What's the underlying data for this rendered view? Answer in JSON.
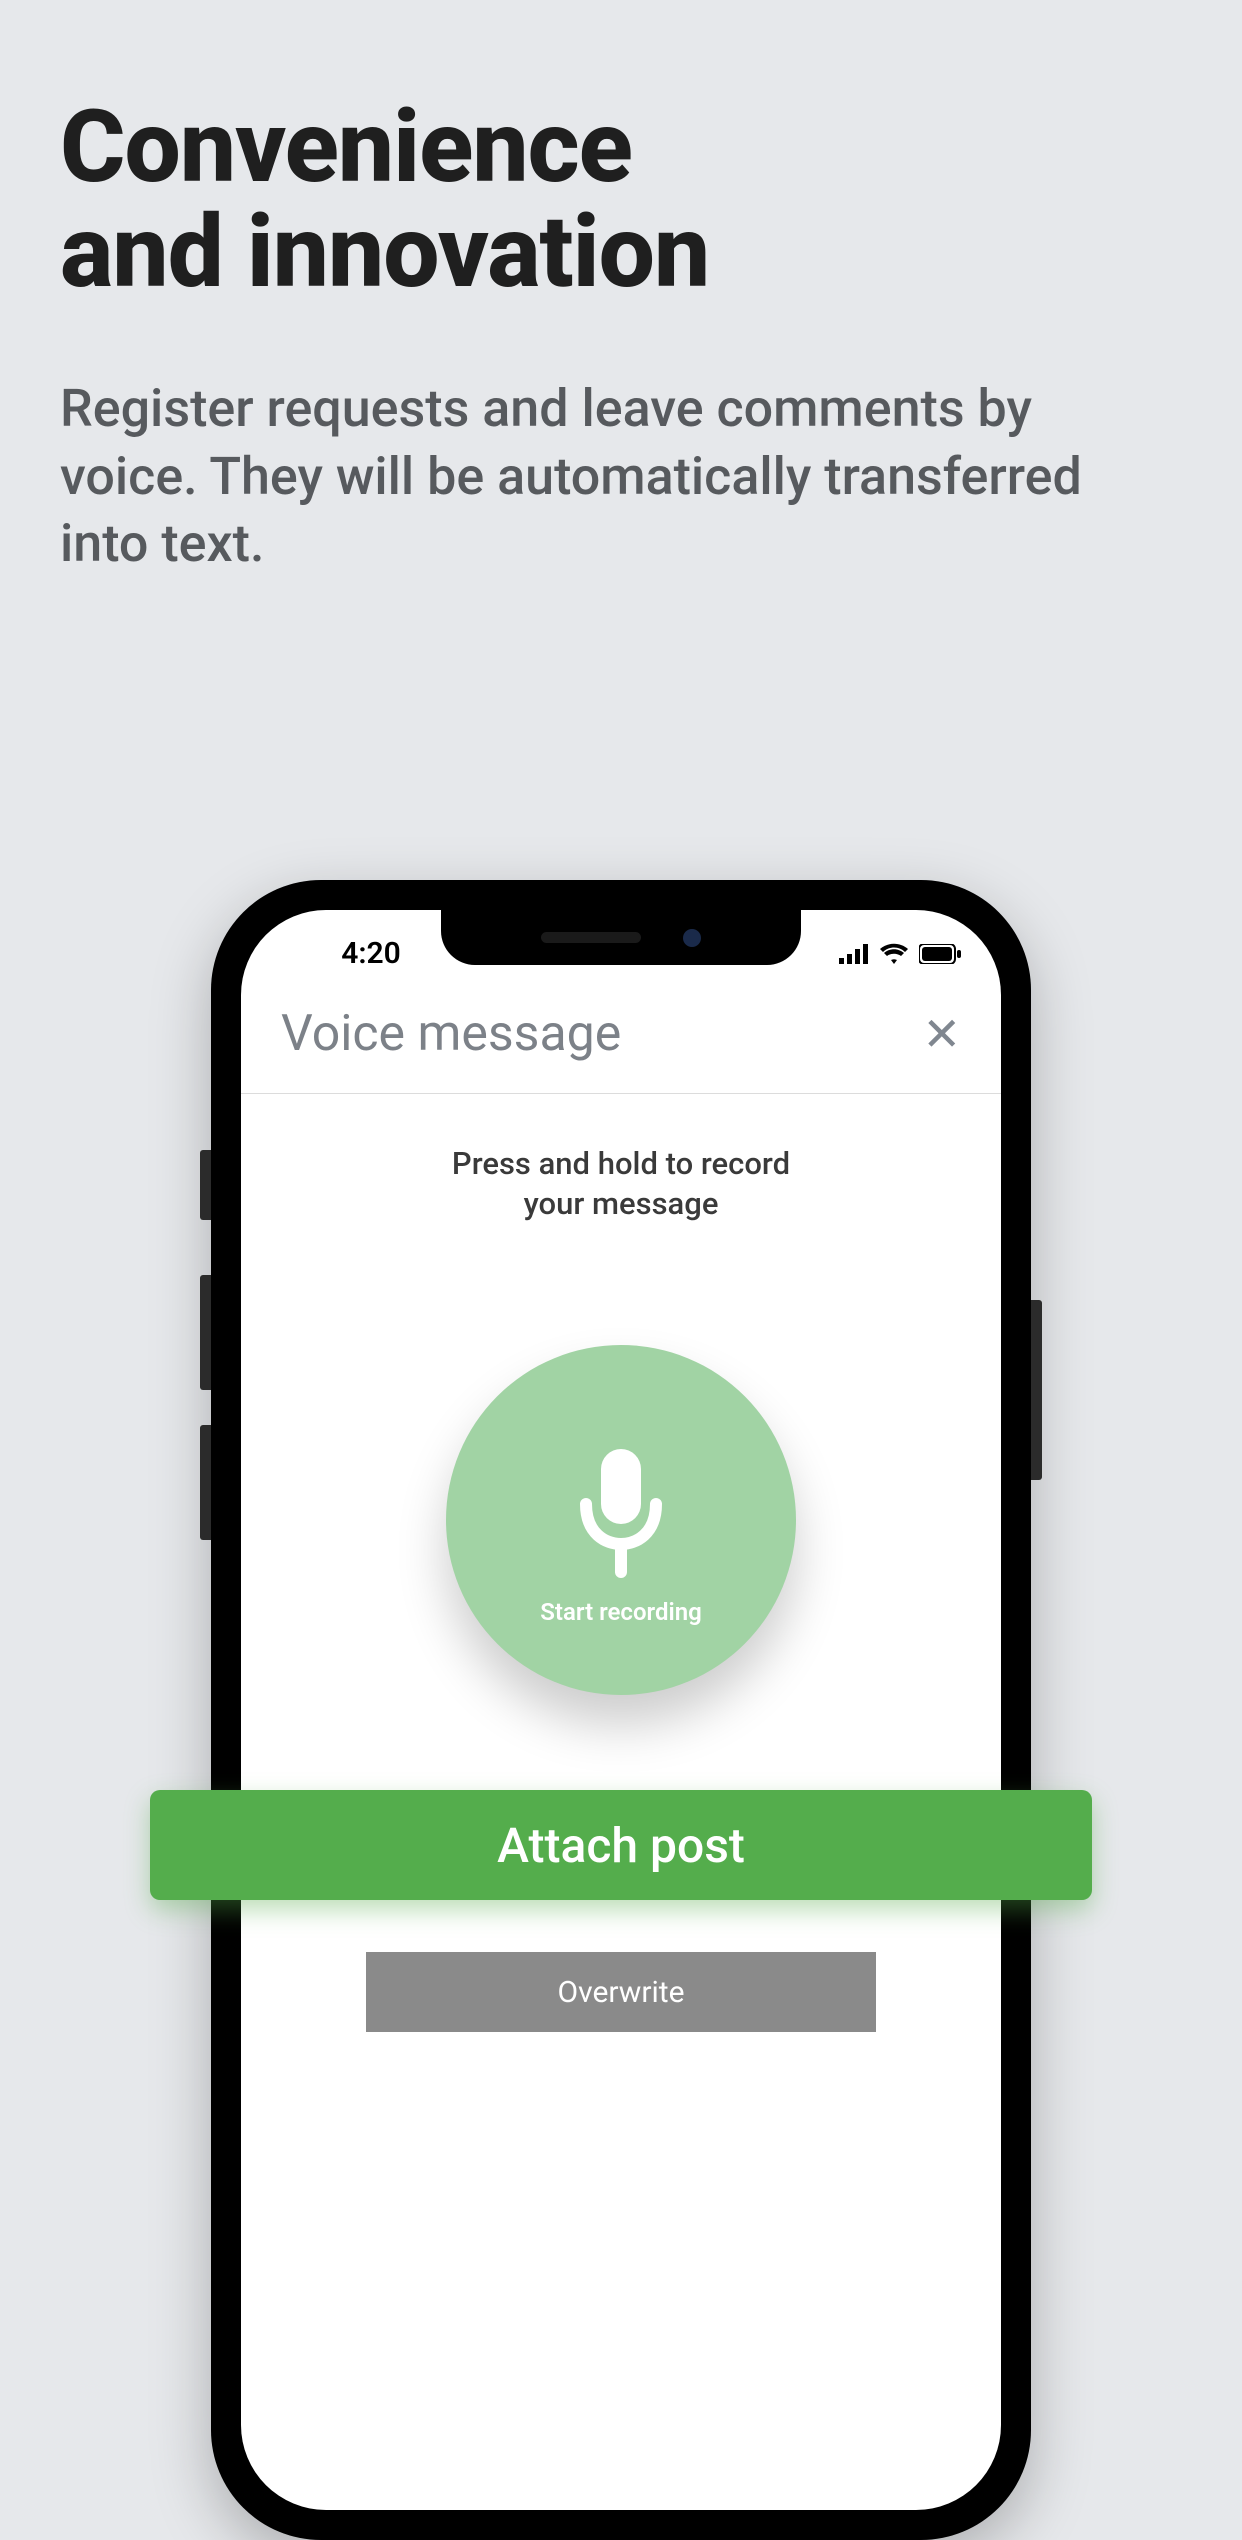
{
  "hero": {
    "title_line1": "Convenience",
    "title_line2": "and innovation",
    "subtitle": "Register requests and leave comments by voice.  They will be automatically transferred into text."
  },
  "status_bar": {
    "time": "4:20"
  },
  "screen": {
    "title": "Voice message",
    "close_label": "✕",
    "instruction_line1": "Press and hold to record",
    "instruction_line2": "your message",
    "record_label": "Start recording"
  },
  "buttons": {
    "attach": "Attach post",
    "overwrite": "Overwrite"
  },
  "colors": {
    "background": "#e6e8eb",
    "accent_green": "#54ad4c",
    "record_green": "#a1d3a4",
    "gray_button": "#8a8a8a"
  }
}
